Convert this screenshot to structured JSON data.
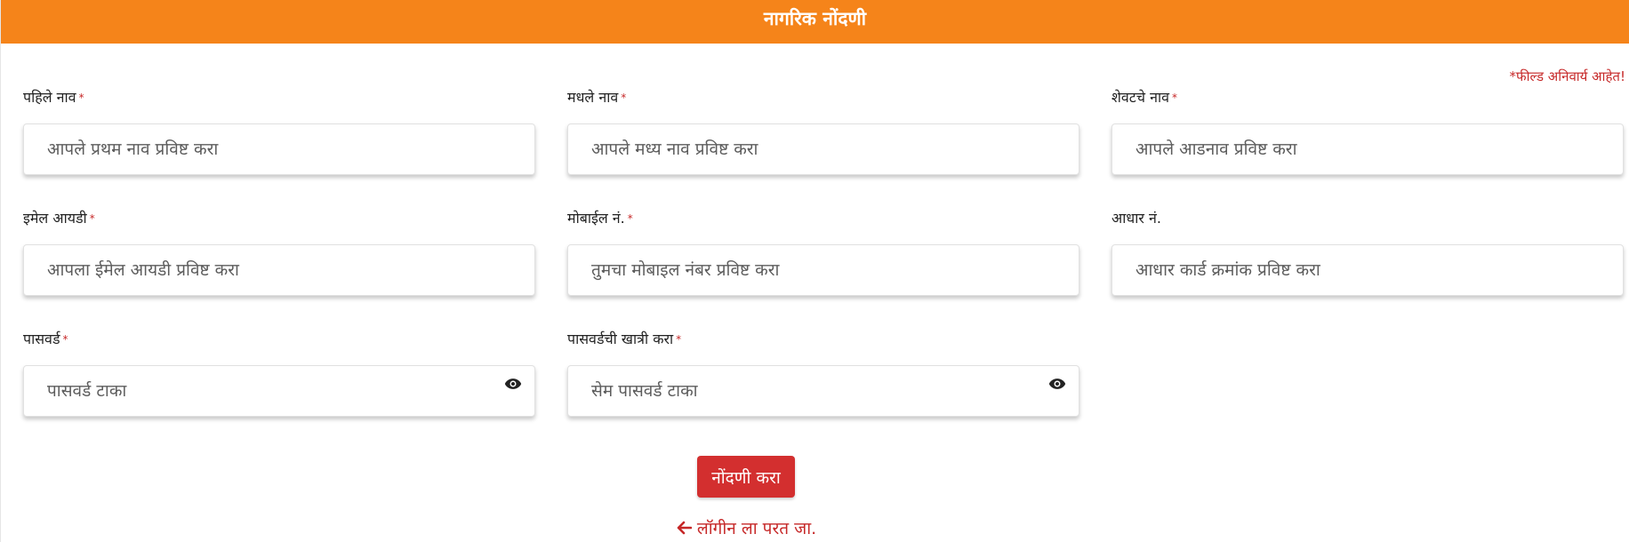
{
  "header": {
    "title": "नागरिक नोंदणी",
    "color": "#f5841a"
  },
  "required_note": {
    "star": "*",
    "text": "फील्ड अनिवार्य आहेत!"
  },
  "fields": {
    "first_name": {
      "label": "पहिले नाव",
      "required": "*",
      "placeholder": "आपले प्रथम नाव प्रविष्ट करा",
      "value": ""
    },
    "middle_name": {
      "label": "मधले नाव",
      "required": "*",
      "placeholder": "आपले मध्य नाव प्रविष्ट करा",
      "value": ""
    },
    "last_name": {
      "label": "शेवटचे नाव",
      "required": "*",
      "placeholder": "आपले आडनाव प्रविष्ट करा",
      "value": ""
    },
    "email": {
      "label": "इमेल आयडी",
      "required": "*",
      "placeholder": "आपला ईमेल आयडी प्रविष्ट करा",
      "value": ""
    },
    "mobile": {
      "label": "मोबाईल नं.",
      "required": "*",
      "placeholder": "तुमचा मोबाइल नंबर प्रविष्ट करा",
      "value": ""
    },
    "aadhaar": {
      "label": "आधार नं.",
      "placeholder": "आधार कार्ड क्रमांक प्रविष्ट करा",
      "value": ""
    },
    "password": {
      "label": "पासवर्ड",
      "required": "*",
      "placeholder": "पासवर्ड टाका",
      "value": "",
      "toggle_icon": "eye-icon"
    },
    "confirm_password": {
      "label": "पासवर्डची खात्री करा",
      "required": "*",
      "placeholder": "सेम पासवर्ड टाका",
      "value": "",
      "toggle_icon": "eye-icon"
    }
  },
  "actions": {
    "submit_label": "नोंदणी करा",
    "submit_color": "#d32f2f",
    "back_link_label": "लॉगीन ला परत जा.",
    "back_icon": "arrow-left-icon"
  }
}
